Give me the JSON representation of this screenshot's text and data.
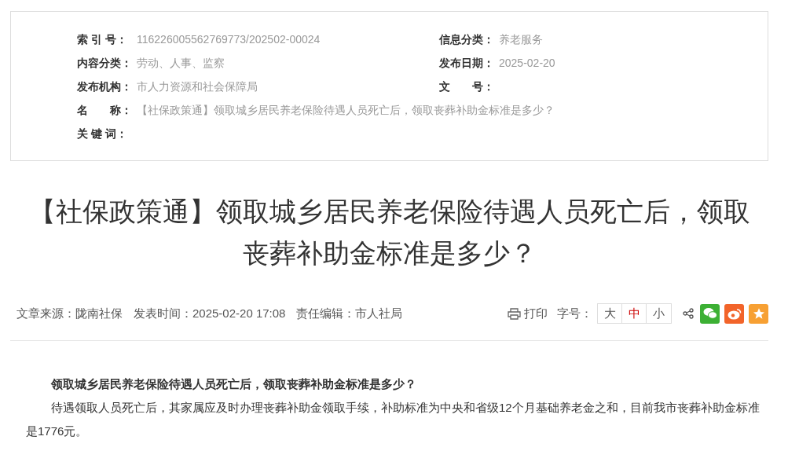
{
  "info_box": {
    "rows": [
      {
        "left": {
          "label": "索 引 号：",
          "value": "116226005562769773/202502-00024"
        },
        "right": {
          "label": "信息分类：",
          "value": "养老服务"
        }
      },
      {
        "left": {
          "label": "内容分类：",
          "value": "劳动、人事、监察"
        },
        "right": {
          "label": "发布日期：",
          "value": "2025-02-20"
        }
      },
      {
        "left": {
          "label": "发布机构：",
          "value": "市人力资源和社会保障局"
        },
        "right": {
          "label": "文　　号："
        }
      },
      {
        "left": {
          "label": "名　　称：",
          "value": "【社保政策通】领取城乡居民养老保险待遇人员死亡后，领取丧葬补助金标准是多少？"
        }
      },
      {
        "left": {
          "label": "关 键 词："
        }
      }
    ]
  },
  "article_title": "【社保政策通】领取城乡居民养老保险待遇人员死亡后，领取丧葬补助金标准是多少？",
  "meta": [
    "文章来源：陇南社保",
    "发表时间：2025-02-20 17:08",
    "责任编辑：市人社局"
  ],
  "toolbar": {
    "print": "打印",
    "font_size_label": "字号：",
    "font_sizes": [
      {
        "label": "大",
        "selected": false
      },
      {
        "label": "中",
        "selected": true
      },
      {
        "label": "小",
        "selected": false
      }
    ],
    "share": [
      {
        "kind": "wechat",
        "color": "#3cb034"
      },
      {
        "kind": "weibo",
        "color": "#f2642a"
      },
      {
        "kind": "favorite",
        "color": "#f7a033"
      }
    ]
  },
  "body": {
    "heading": "领取城乡居民养老保险待遇人员死亡后，领取丧葬补助金标准是多少？",
    "paragraphs": [
      "待遇领取人员死亡后，其家属应及时办理丧葬补助金领取手续，补助标准为中央和省级12个月基础养老金之和，目前我市丧葬补助金标准是1776元。"
    ]
  }
}
